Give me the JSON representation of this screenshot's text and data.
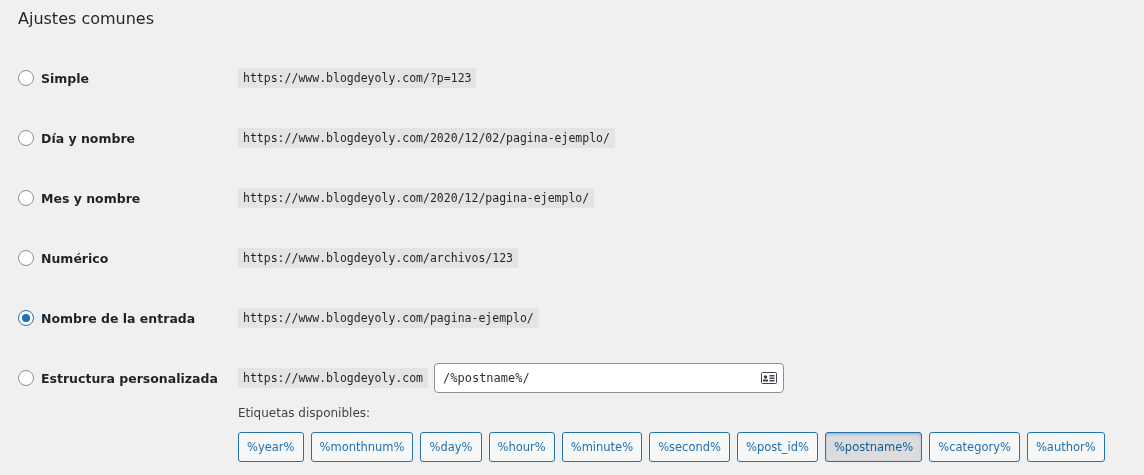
{
  "heading": "Ajustes comunes",
  "options": [
    {
      "label": "Simple",
      "example": "https://www.blogdeyoly.com/?p=123",
      "selected": false
    },
    {
      "label": "Día y nombre",
      "example": "https://www.blogdeyoly.com/2020/12/02/pagina-ejemplo/",
      "selected": false
    },
    {
      "label": "Mes y nombre",
      "example": "https://www.blogdeyoly.com/2020/12/pagina-ejemplo/",
      "selected": false
    },
    {
      "label": "Numérico",
      "example": "https://www.blogdeyoly.com/archivos/123",
      "selected": false
    },
    {
      "label": "Nombre de la entrada",
      "example": "https://www.blogdeyoly.com/pagina-ejemplo/",
      "selected": true
    },
    {
      "label": "Estructura personalizada",
      "example": "https://www.blogdeyoly.com",
      "selected": false,
      "kind": "custom",
      "value": "/%postname%/"
    }
  ],
  "tags_label": "Etiquetas disponibles:",
  "tags": [
    {
      "label": "%year%",
      "selected": false
    },
    {
      "label": "%monthnum%",
      "selected": false
    },
    {
      "label": "%day%",
      "selected": false
    },
    {
      "label": "%hour%",
      "selected": false
    },
    {
      "label": "%minute%",
      "selected": false
    },
    {
      "label": "%second%",
      "selected": false
    },
    {
      "label": "%post_id%",
      "selected": false
    },
    {
      "label": "%postname%",
      "selected": true
    },
    {
      "label": "%category%",
      "selected": false
    },
    {
      "label": "%author%",
      "selected": false
    }
  ]
}
